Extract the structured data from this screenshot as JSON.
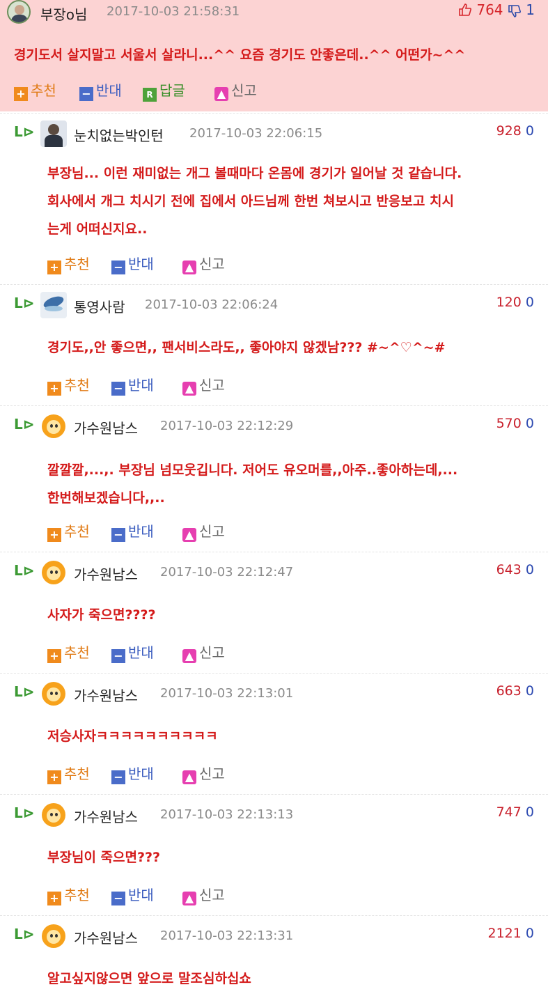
{
  "post": {
    "nickname": "부장o님",
    "date": "2017-10-03 21:58:31",
    "up_count": "764",
    "down_count": "1",
    "content": "경기도서 살지말고 서울서 살라니...^^ 요즘 경기도 안좋은데..^^ 어떤가~^^",
    "actions": {
      "recommend": "추천",
      "oppose": "반대",
      "reply": "답글",
      "report": "신고",
      "reply_icon": "R"
    },
    "icons": {
      "up": "thumbs-up-icon",
      "down": "thumbs-down-icon"
    }
  },
  "action_labels": {
    "recommend": "추천",
    "oppose": "반대",
    "report": "신고"
  },
  "reply_arrow": "L⊳",
  "comments": [
    {
      "nickname": "눈치없는박인턴",
      "date": "2017-10-03 22:06:15",
      "up": "928",
      "down": "0",
      "lines": [
        "부장님... 이런 재미없는 개그 볼때마다 온몸에 경기가 일어날 것 같습니다.",
        "회사에서 개그 치시기 전에 집에서 아드님께 한번 쳐보시고 반응보고 치시",
        "는게 어떠신지요.."
      ]
    },
    {
      "nickname": "통영사람",
      "date": "2017-10-03 22:06:24",
      "up": "120",
      "down": "0",
      "lines": [
        "경기도,,안 좋으면,, 팬서비스라도,, 좋아야지 않겠남??? #~^♡^~#"
      ]
    },
    {
      "nickname": "가수원남스",
      "date": "2017-10-03 22:12:29",
      "up": "570",
      "down": "0",
      "lines": [
        "깔깔깔,...,. 부장님 넘모웃깁니다. 저어도 유오머를,,아주..좋아하는데,...",
        "한번해보겠습니다,,.."
      ]
    },
    {
      "nickname": "가수원남스",
      "date": "2017-10-03 22:12:47",
      "up": "643",
      "down": "0",
      "lines": [
        "사자가 죽으면????"
      ]
    },
    {
      "nickname": "가수원남스",
      "date": "2017-10-03 22:13:01",
      "up": "663",
      "down": "0",
      "lines": [
        "저승사자ㅋㅋㅋㅋㅋㅋㅋㅋㅋㅋ"
      ]
    },
    {
      "nickname": "가수원남스",
      "date": "2017-10-03 22:13:13",
      "up": "747",
      "down": "0",
      "lines": [
        "부장님이 죽으면???"
      ]
    },
    {
      "nickname": "가수원남스",
      "date": "2017-10-03 22:13:31",
      "up": "2121",
      "down": "0",
      "lines": [
        "알고싶지않으면 앞으로 말조심하십쇼"
      ]
    }
  ],
  "colors": {
    "post_bg": "#fcd3d3",
    "content_red": "#d41a1a",
    "up_red": "#c8202c",
    "down_blue": "#2b48b0"
  }
}
